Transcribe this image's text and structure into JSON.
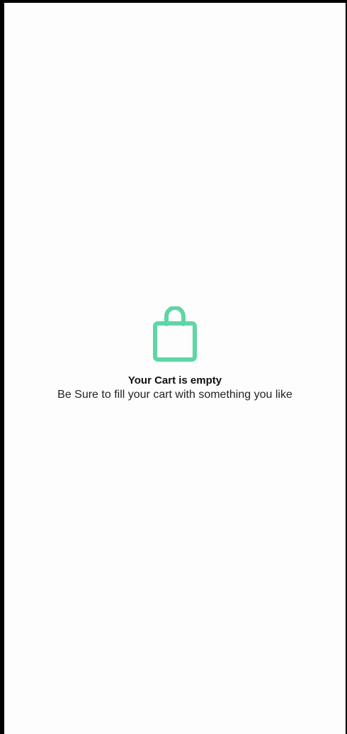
{
  "empty_cart": {
    "icon": "shopping-bag-icon",
    "accent_color": "#5ed6a3",
    "title": "Your Cart is empty",
    "subtitle": "Be Sure to fill your cart with something you like"
  }
}
